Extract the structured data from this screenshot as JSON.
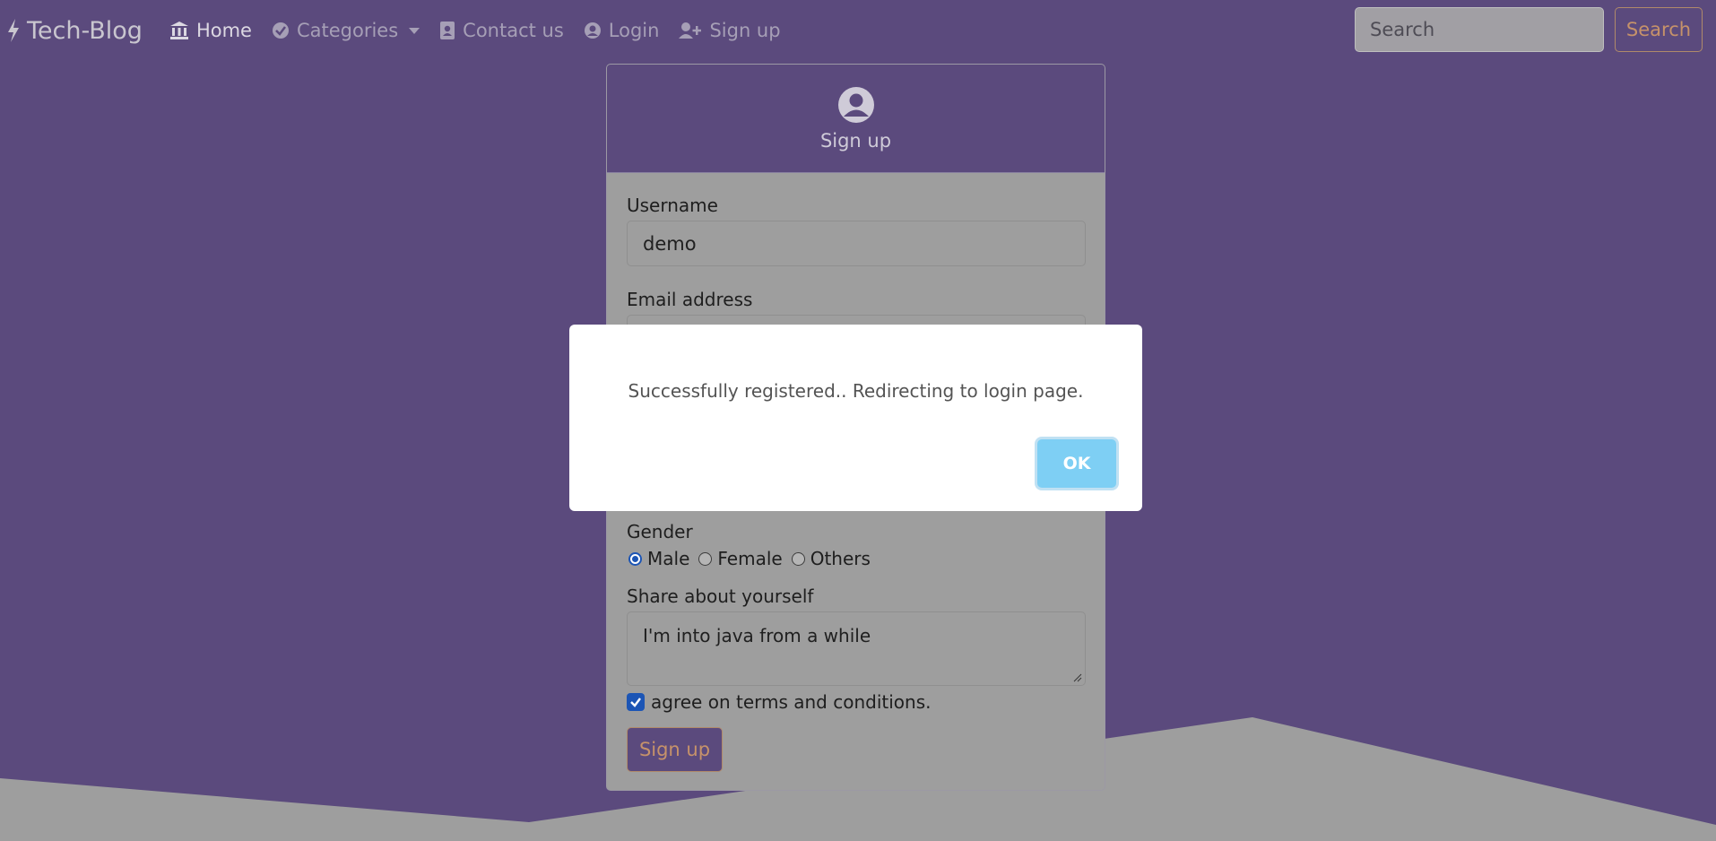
{
  "navbar": {
    "brand": "Tech-Blog",
    "items": [
      {
        "label": "Home",
        "icon": "bank-icon"
      },
      {
        "label": "Categories",
        "icon": "check-circle-icon"
      },
      {
        "label": "Contact us",
        "icon": "address-book-icon"
      },
      {
        "label": "Login",
        "icon": "user-circle-icon"
      },
      {
        "label": "Sign up",
        "icon": "user-plus-icon"
      }
    ],
    "search_placeholder": "Search",
    "search_button": "Search"
  },
  "signup_card": {
    "title": "Sign up",
    "icon": "user-circle-icon",
    "username_label": "Username",
    "username_value": "demo",
    "email_label": "Email address",
    "gender_label": "Gender",
    "gender_options": [
      "Male",
      "Female",
      "Others"
    ],
    "gender_selected": "Male",
    "about_label": "Share about yourself",
    "about_value": "I'm into java from a while",
    "terms_label": "agree on terms and conditions.",
    "submit_label": "Sign up"
  },
  "dialog": {
    "message": "Successfully registered.. Redirecting to login page.",
    "ok_label": "OK"
  },
  "colors": {
    "background": "#5b4a7d",
    "card": "#9e9e9e",
    "accent": "#c6926a",
    "ok_button": "#7ecff4"
  }
}
